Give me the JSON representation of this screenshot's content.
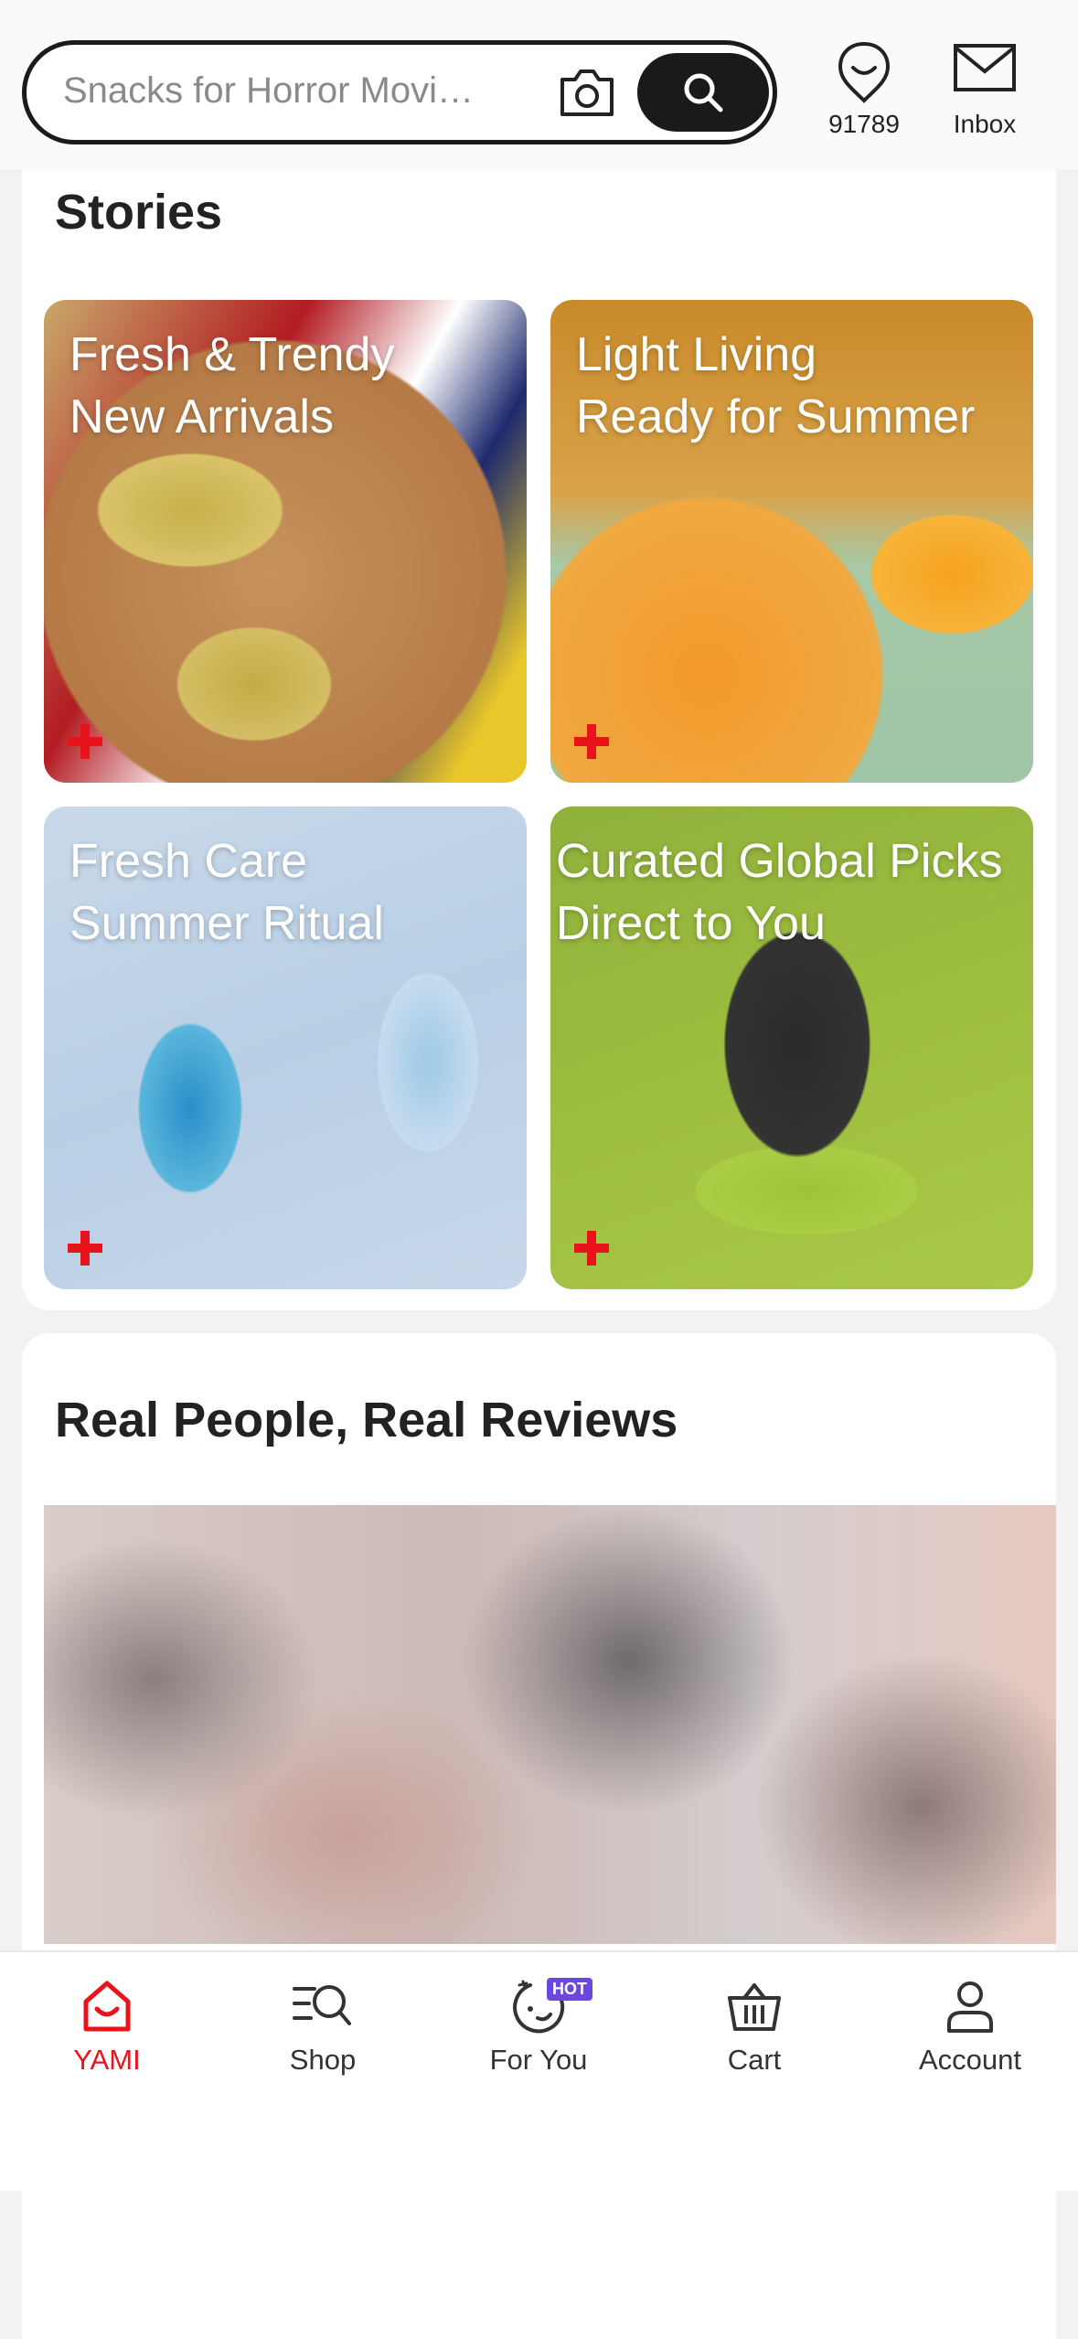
{
  "search": {
    "placeholder": "Snacks for Horror Movi…",
    "camera_icon": "camera-icon",
    "search_icon": "search-icon"
  },
  "header": {
    "points_value": "91789",
    "inbox_label": "Inbox"
  },
  "stories": {
    "title": "Stories",
    "tiles": [
      {
        "line1": "Fresh & Trendy",
        "line2": "New Arrivals"
      },
      {
        "line1": "Light Living",
        "line2": "Ready for Summer"
      },
      {
        "line1": "Fresh Care",
        "line2": "Summer Ritual"
      },
      {
        "line1": "Curated Global Picks",
        "line2": "Direct to You"
      }
    ]
  },
  "reviews": {
    "title": "Real People, Real Reviews"
  },
  "bottom_nav": {
    "items": [
      {
        "label": "YAMI",
        "icon": "home-smile-icon",
        "active": true
      },
      {
        "label": "Shop",
        "icon": "category-search-icon"
      },
      {
        "label": "For You",
        "icon": "for-you-icon",
        "badge": "HOT"
      },
      {
        "label": "Cart",
        "icon": "basket-icon"
      },
      {
        "label": "Account",
        "icon": "user-icon"
      }
    ]
  },
  "colors": {
    "accent": "#e8131b",
    "badge": "#6b46e0",
    "dark": "#1a1a1a"
  }
}
